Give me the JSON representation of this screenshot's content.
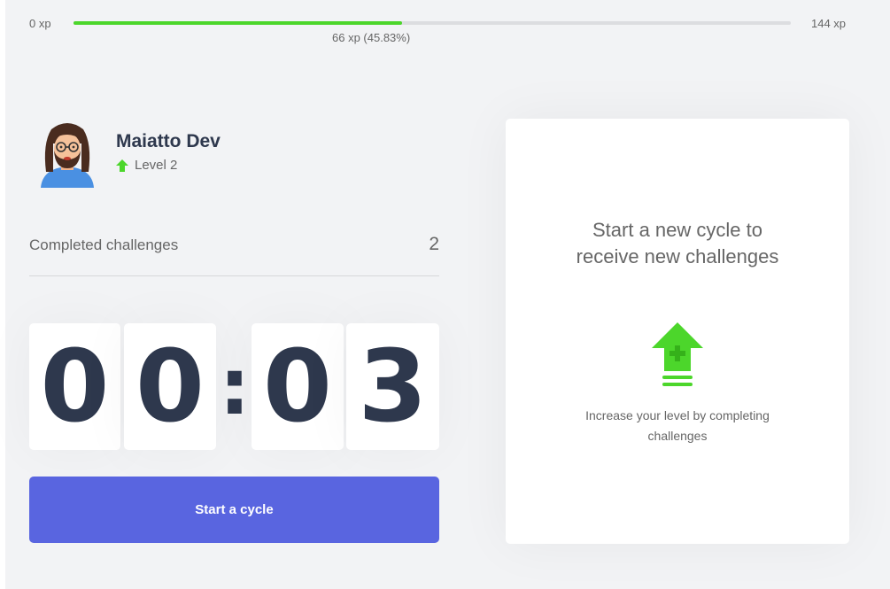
{
  "xp_bar": {
    "min_label": "0 xp",
    "max_label": "144 xp",
    "current_label": "66 xp (45.83%)",
    "progress_percent": 45.83,
    "fill_color": "#4cd62b"
  },
  "profile": {
    "name": "Maiatto Dev",
    "level_label": "Level 2",
    "level_icon": "level-up-arrow-icon"
  },
  "challenges": {
    "label": "Completed challenges",
    "count": "2"
  },
  "countdown": {
    "minute_tens": "0",
    "minute_ones": "0",
    "separator": ":",
    "second_tens": "0",
    "second_ones": "3"
  },
  "cycle_button": {
    "label": "Start a cycle",
    "color": "#5965e0"
  },
  "challenge_card": {
    "title_line1": "Start a new cycle to",
    "title_line2": "receive new challenges",
    "icon": "level-up-icon",
    "description_line1": "Increase your level by completing",
    "description_line2": "challenges"
  }
}
